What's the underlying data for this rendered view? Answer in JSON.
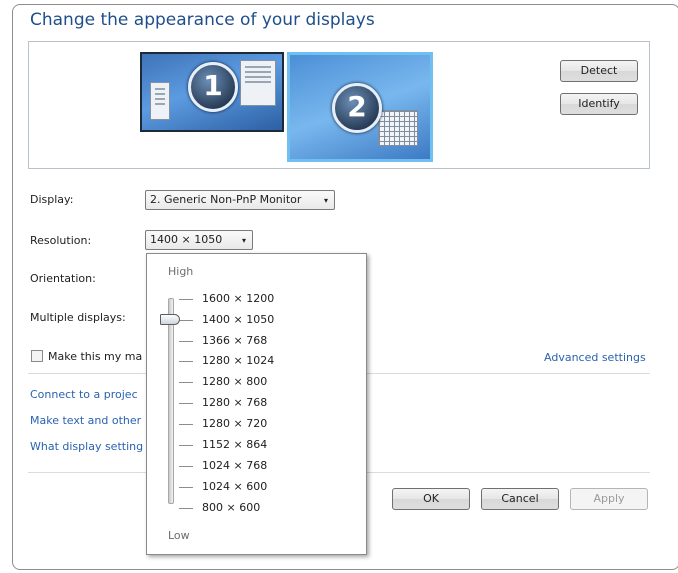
{
  "title": "Change the appearance of your displays",
  "monitors": [
    {
      "number": "1",
      "selected": false
    },
    {
      "number": "2",
      "selected": true
    }
  ],
  "buttons": {
    "detect": "Detect",
    "identify": "Identify",
    "ok": "OK",
    "cancel": "Cancel",
    "apply": "Apply"
  },
  "fields": {
    "display_label": "Display:",
    "display_value": "2. Generic Non-PnP Monitor",
    "resolution_label": "Resolution:",
    "resolution_value": "1400 × 1050",
    "orientation_label": "Orientation:",
    "multiple_displays_label": "Multiple displays:"
  },
  "checkbox_label": "Make this my ma",
  "advanced_link": "Advanced settings",
  "links": [
    "Connect to a projec",
    "Make text and other",
    "What display setting"
  ],
  "resolution_dropdown": {
    "high_label": "High",
    "low_label": "Low",
    "options": [
      "1600 × 1200",
      "1400 × 1050",
      "1366 × 768",
      "1280 × 1024",
      "1280 × 800",
      "1280 × 768",
      "1280 × 720",
      "1152 × 864",
      "1024 × 768",
      "1024 × 600",
      "800 × 600"
    ],
    "selected": "1400 × 1050"
  },
  "icons": {
    "dropdown_arrow": "▾"
  },
  "colors": {
    "title": "#1f4f8b",
    "link": "#2a62b0",
    "selected_monitor_border": "#6fc0f0"
  }
}
